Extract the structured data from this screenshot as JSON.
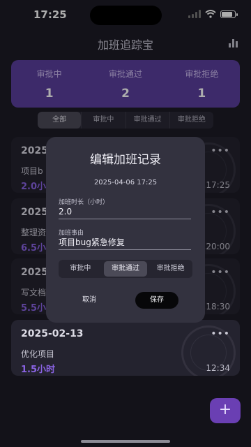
{
  "status_bar": {
    "time": "17:25"
  },
  "header": {
    "title": "加班追踪宝",
    "chart_icon": "bar-chart-icon"
  },
  "summary": [
    {
      "label": "审批中",
      "count": "1"
    },
    {
      "label": "审批通过",
      "count": "2"
    },
    {
      "label": "审批拒绝",
      "count": "1"
    }
  ],
  "filter_tabs": [
    "全部",
    "审批中",
    "审批通过",
    "审批拒绝"
  ],
  "records": [
    {
      "date": "2025-",
      "desc": "项目b",
      "hours": "2.0小",
      "time": "17:25"
    },
    {
      "date": "2025",
      "desc": "整理资",
      "hours": "6.5小",
      "time": "20:00"
    },
    {
      "date": "2025",
      "desc": "写文档",
      "hours": "5.5小",
      "time": "18:30"
    },
    {
      "date": "2025-02-13",
      "desc": "优化项目",
      "hours": "1.5小时",
      "time": "12:34"
    }
  ],
  "dialog": {
    "title": "编辑加班记录",
    "timestamp": "2025-04-06 17:25",
    "hours_label": "加班时长（小时）",
    "hours_value": "2.0",
    "reason_label": "加班事由",
    "reason_value": "项目bug紧急修复",
    "status_options": [
      "审批中",
      "审批通过",
      "审批拒绝"
    ],
    "cancel_label": "取消",
    "save_label": "保存"
  },
  "fab": {
    "label": "+"
  },
  "colors": {
    "accent": "#5b3f9c",
    "hours": "#8a63e3",
    "background": "#1c1b25"
  }
}
